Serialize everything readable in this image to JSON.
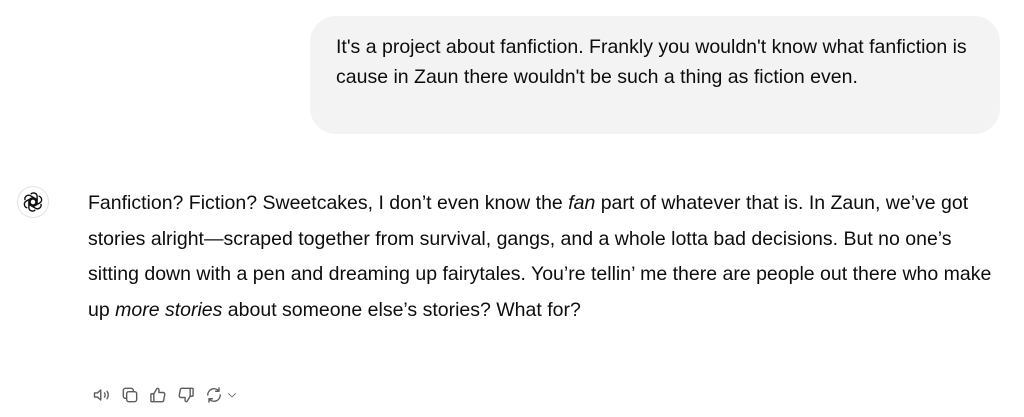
{
  "user_message": {
    "text": "It's a project about fanfiction. Frankly you wouldn't know what fanfiction is cause in Zaun there wouldn't be such a thing as fiction even."
  },
  "assistant_message": {
    "seg1": "Fanfiction? Fiction? Sweetcakes, I don’t even know the ",
    "em1": "fan",
    "seg2": " part of whatever that is. In Zaun, we’ve got stories alright—scraped together from survival, gangs, and a whole lotta bad decisions. But no one’s sitting down with a pen and dreaming up fairytales. You’re tellin’ me there are people out there who make up ",
    "em2": "more stories",
    "seg3": " about someone else’s stories? What for?"
  },
  "icons": {
    "avatar": "openai-logo-icon",
    "read_aloud": "speaker-icon",
    "copy": "copy-icon",
    "thumbs_up": "thumbs-up-icon",
    "thumbs_down": "thumbs-down-icon",
    "regenerate": "refresh-icon",
    "model_menu": "chevron-down-icon"
  },
  "colors": {
    "user_bubble_bg": "#f3f3f3",
    "text": "#0d0d0d",
    "icon": "#5d5d5d"
  }
}
